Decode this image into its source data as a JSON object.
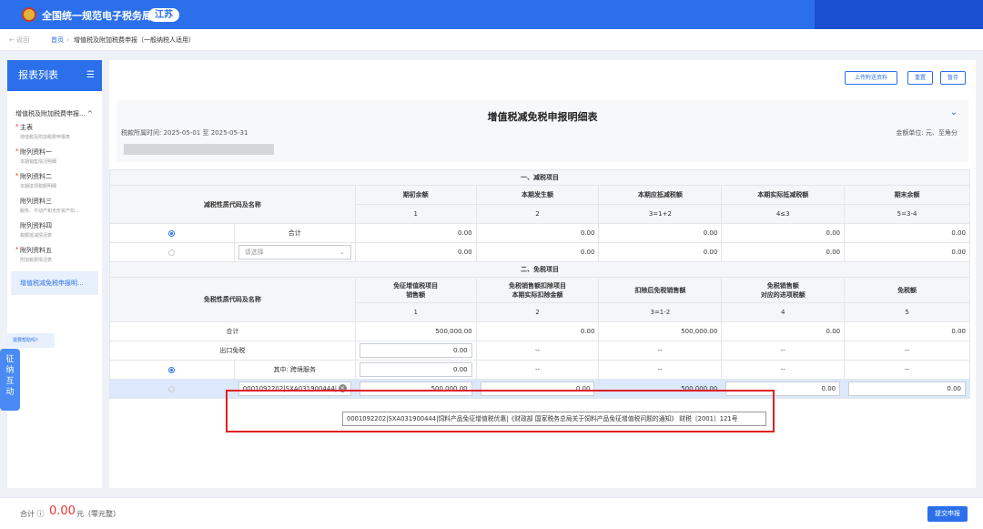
{
  "topbar": {
    "site_title": "全国统一规范电子税务局",
    "region": "江苏"
  },
  "breadcrumb": {
    "back": "← 返回",
    "home": "首页",
    "sep": "›",
    "current": "增值税及附加税费申报（一般纳税人适用）"
  },
  "sidebar": {
    "title": "报表列表",
    "group": "增值税及附加税费申报...",
    "items": [
      {
        "star": "*",
        "title": "主表",
        "sub": "增值税及附加税费申报表"
      },
      {
        "star": "*",
        "title": "附列资料一",
        "sub": "本期销售情况明细"
      },
      {
        "star": "*",
        "title": "附列资料二",
        "sub": "本期进项税额明细"
      },
      {
        "star": "",
        "title": "附列资料三",
        "sub": "服务、不动产和无形资产扣..."
      },
      {
        "star": "",
        "title": "附列资料四",
        "sub": "税额抵减情况表"
      },
      {
        "star": "*",
        "title": "附列资料五",
        "sub": "附加税费情况表"
      }
    ],
    "active": "增值税减免税申报明...",
    "help": "需要帮助吗?",
    "float": [
      "征",
      "纳",
      "互",
      "动"
    ]
  },
  "toolbar": {
    "upload": "上传附送资料",
    "reset": "重置",
    "save": "暂存"
  },
  "form": {
    "title": "增值税减免税申报明细表",
    "period": "税款所属时间: 2025-05-01 至 2025-05-31",
    "unit": "金额单位: 元、至角分"
  },
  "table": {
    "sec1": "一、减税项目",
    "sec1_name": "减税性质代码及名称",
    "sec1_cols": [
      "期初余额",
      "本期发生额",
      "本期应抵减税额",
      "本期实际抵减税额",
      "期末余额"
    ],
    "sec1_nums": [
      "1",
      "2",
      "3=1+2",
      "4≤3",
      "5=3-4"
    ],
    "total_label": "合计",
    "r1": [
      "0.00",
      "0.00",
      "0.00",
      "0.00",
      "0.00"
    ],
    "select_placeholder": "请选择",
    "r2": [
      "0.00",
      "0.00",
      "0.00",
      "0.00",
      "0.00"
    ],
    "sec2": "二、免税项目",
    "sec2_name": "免税性质代码及名称",
    "sec2_cols": [
      [
        "免征增值税项目",
        "销售额"
      ],
      [
        "免税销售额扣除项目",
        "本期实际扣除金额"
      ],
      [
        "扣除后免税销售额",
        ""
      ],
      [
        "免税销售额",
        "对应的进项税额"
      ],
      [
        "免税额",
        ""
      ]
    ],
    "sec2_nums": [
      "1",
      "2",
      "3=1-2",
      "4",
      "5"
    ],
    "t_total": "合计",
    "t_total_vals": [
      "500,000.00",
      "0.00",
      "500,000.00",
      "0.00",
      "0.00"
    ],
    "export_label": "出口免税",
    "export_vals": [
      "0.00",
      "--",
      "--",
      "--",
      "--"
    ],
    "cross_label": "其中: 跨境服务",
    "cross_vals": [
      "0.00",
      "--",
      "--",
      "--",
      "--"
    ],
    "code_value": "0001092202|SXA031900444|...",
    "hl_vals": [
      "500,000.00",
      "0.00",
      "500,000.00",
      "0.00",
      "0.00"
    ],
    "tooltip": "0001092202|SXA031900444|饲料产品免征增值税优惠|《财政部 国家税务总局关于饲料产品免征增值税问题的通知》 财税〔2001〕121号"
  },
  "footer": {
    "label": "合计 ⓘ",
    "amount": "0.00",
    "unit": "元（零元整）",
    "submit": "提交申报"
  }
}
